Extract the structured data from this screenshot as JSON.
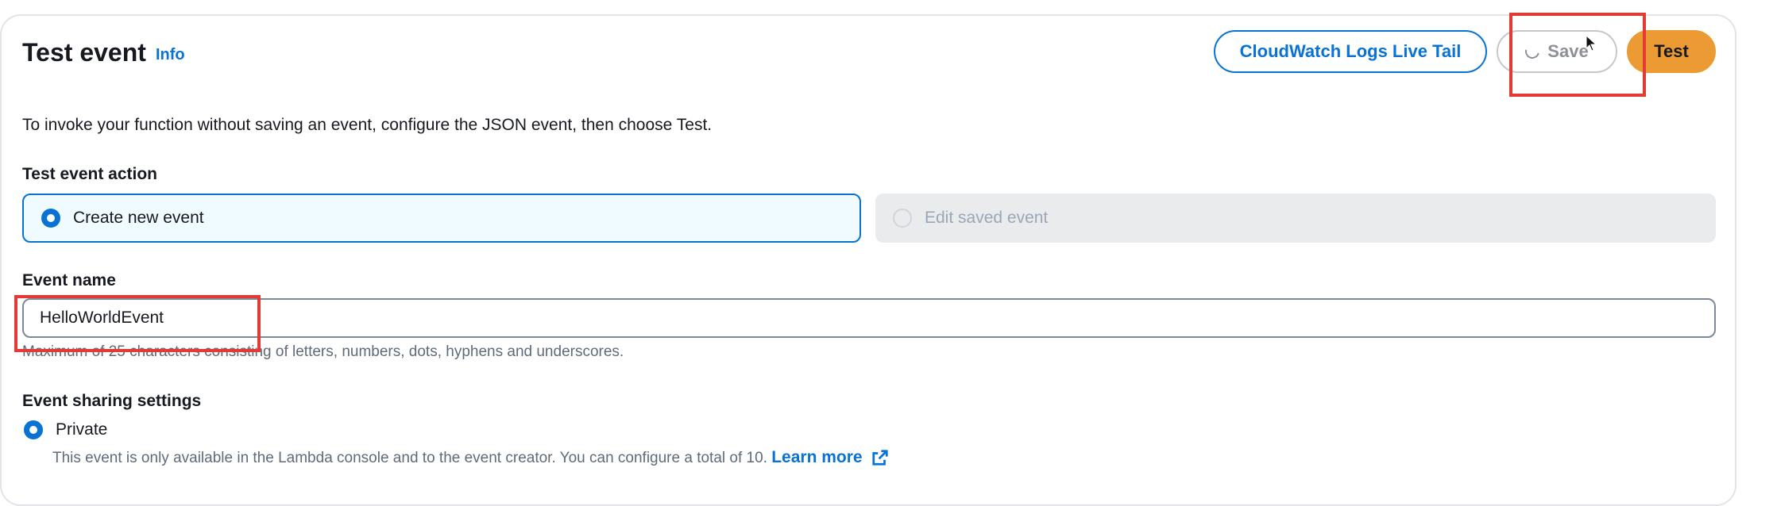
{
  "header": {
    "title": "Test event",
    "info_link": "Info"
  },
  "toolbar": {
    "live_tail_label": "CloudWatch Logs Live Tail",
    "save_label": "Save",
    "test_label": "Test"
  },
  "description": "To invoke your function without saving an event, configure the JSON event, then choose Test.",
  "test_event_action": {
    "label": "Test event action",
    "options": [
      {
        "label": "Create new event",
        "selected": true,
        "enabled": true
      },
      {
        "label": "Edit saved event",
        "selected": false,
        "enabled": false
      }
    ]
  },
  "event_name": {
    "label": "Event name",
    "value": "HelloWorldEvent",
    "constraint": "Maximum of 25 characters consisting of letters, numbers, dots, hyphens and underscores."
  },
  "sharing": {
    "label": "Event sharing settings",
    "private_label": "Private",
    "private_description": "This event is only available in the Lambda console and to the event creator. You can configure a total of 10.",
    "learn_more": "Learn more"
  },
  "icons": {
    "spinner": "loading-spinner-icon",
    "external_link": "external-link-icon",
    "cursor": "mouse-pointer-icon"
  },
  "colors": {
    "accent_blue": "#0972d3",
    "test_button_orange": "#ec9a34",
    "highlight_red": "#e53935",
    "selected_tile_bg": "#f0fbff",
    "disabled_tile_bg": "#e9ebed"
  }
}
